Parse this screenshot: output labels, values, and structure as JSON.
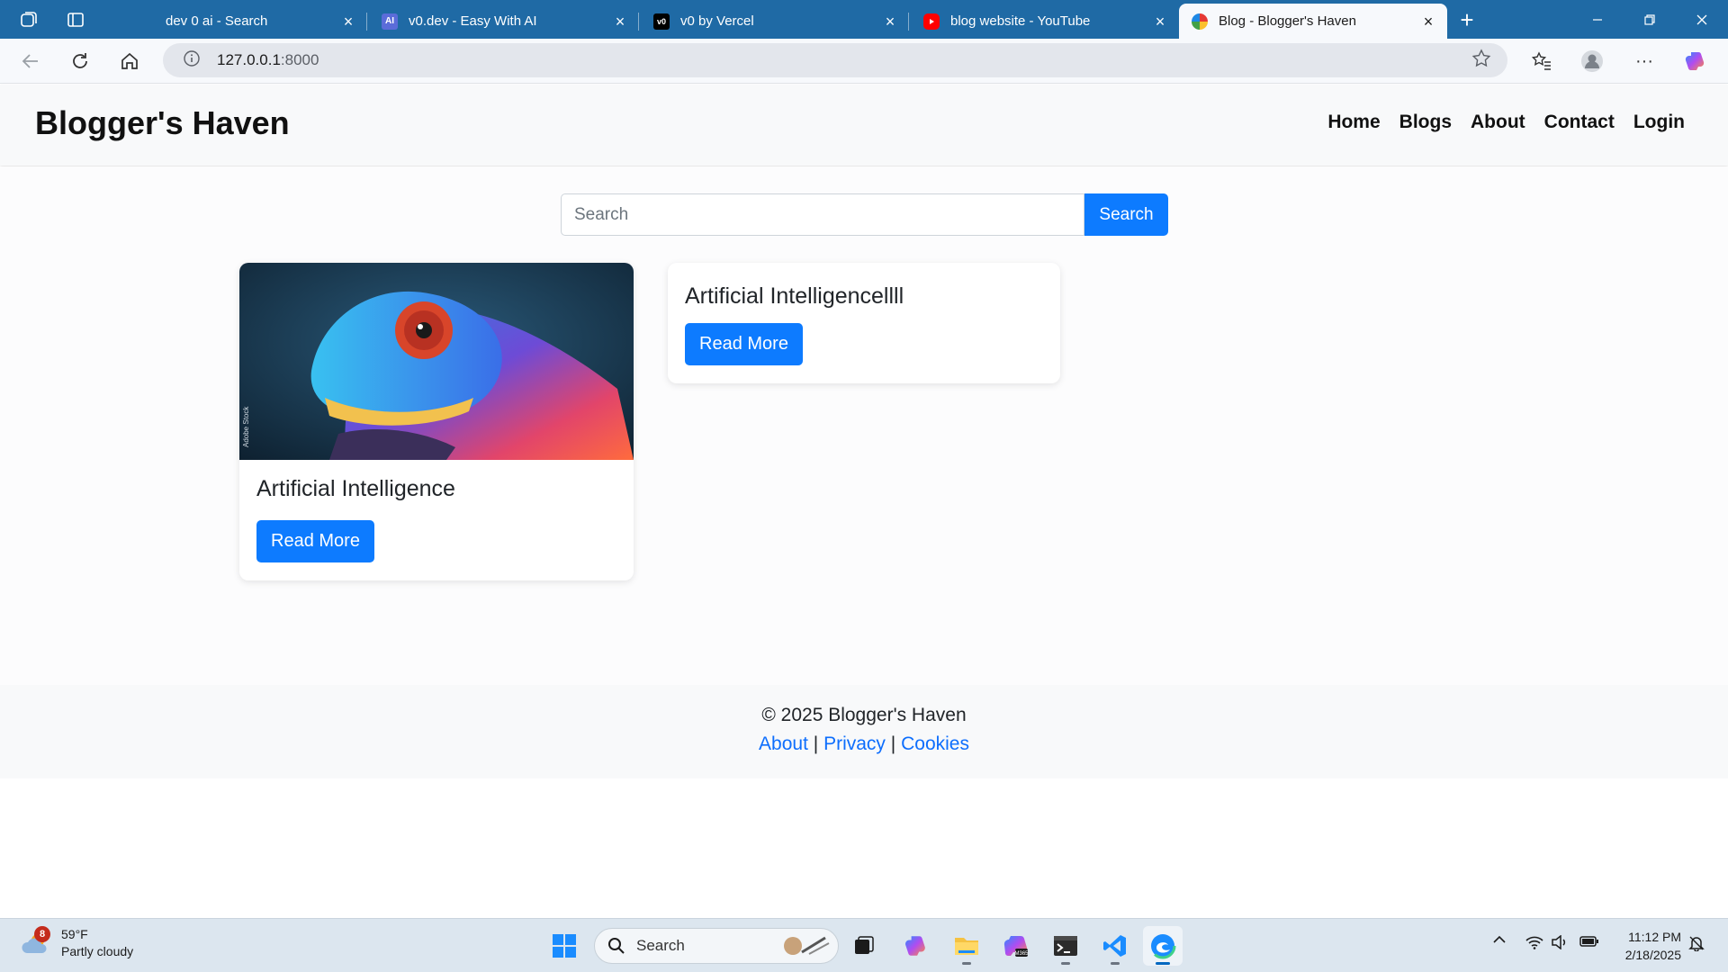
{
  "browser": {
    "tabs": [
      {
        "title": "dev 0 ai - Search",
        "icon": "bing-search-icon",
        "active": false
      },
      {
        "title": "v0.dev - Easy With AI",
        "icon": "ai-favicon-icon",
        "active": false
      },
      {
        "title": "v0 by Vercel",
        "icon": "v0-logo-icon",
        "active": false
      },
      {
        "title": "blog website - YouTube",
        "icon": "youtube-icon",
        "active": false
      },
      {
        "title": "Blog - Blogger's Haven",
        "icon": "globe-color-icon",
        "active": true
      }
    ],
    "url_host": "127.0.0.1",
    "url_port": ":8000"
  },
  "site": {
    "brand": "Blogger's Haven",
    "nav": [
      "Home",
      "Blogs",
      "About",
      "Contact",
      "Login"
    ],
    "search": {
      "placeholder": "Search",
      "button": "Search"
    },
    "posts": [
      {
        "title": "Artificial Intelligence",
        "button": "Read More",
        "has_image": true,
        "image_subject": "chameleon-image"
      },
      {
        "title": "Artificial Intelligencellll",
        "button": "Read More",
        "has_image": false
      }
    ],
    "footer": {
      "copyright": "© 2025 Blogger's Haven",
      "links": [
        "About",
        "Privacy",
        "Cookies"
      ],
      "separator": "|"
    }
  },
  "taskbar": {
    "weather": {
      "temp": "59°F",
      "condition": "Partly cloudy",
      "badge": "8"
    },
    "search_placeholder": "Search",
    "time": "11:12 PM",
    "date": "2/18/2025"
  },
  "colors": {
    "tabstrip": "#1f6aa5",
    "primary_button": "#0d7bff",
    "link": "#0d6efd"
  }
}
